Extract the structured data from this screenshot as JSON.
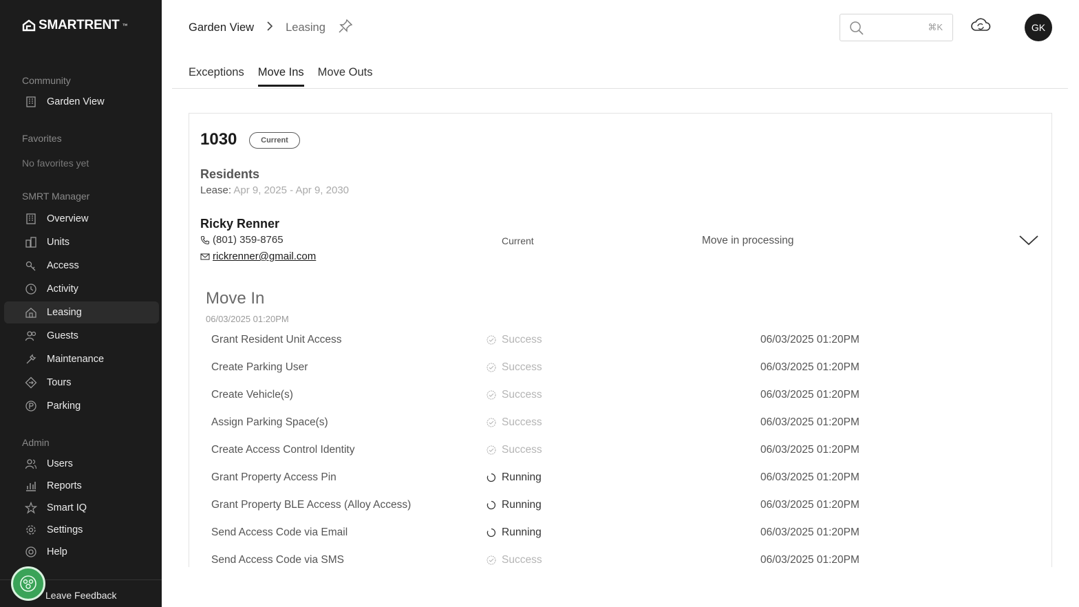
{
  "app": {
    "logo_text": "SMARTRENT",
    "logo_tm": "™"
  },
  "sidebar": {
    "community_label": "Community",
    "community_item": {
      "label": "Garden View",
      "icon": "building-icon"
    },
    "favorites_label": "Favorites",
    "no_favorites": "No favorites yet",
    "manager_label": "SMRT Manager",
    "manager_items": [
      {
        "label": "Overview",
        "icon": "building-icon"
      },
      {
        "label": "Units",
        "icon": "units-icon"
      },
      {
        "label": "Access",
        "icon": "key-icon"
      },
      {
        "label": "Activity",
        "icon": "clock-icon"
      },
      {
        "label": "Leasing",
        "icon": "leasing-icon",
        "active": true
      },
      {
        "label": "Guests",
        "icon": "guests-icon"
      },
      {
        "label": "Maintenance",
        "icon": "wrench-icon"
      },
      {
        "label": "Tours",
        "icon": "tours-icon"
      },
      {
        "label": "Parking",
        "icon": "parking-icon"
      }
    ],
    "admin_label": "Admin",
    "admin_items": [
      {
        "label": "Users",
        "icon": "users-icon"
      },
      {
        "label": "Reports",
        "icon": "reports-icon"
      },
      {
        "label": "Smart IQ",
        "icon": "star-icon"
      },
      {
        "label": "Settings",
        "icon": "gear-icon"
      },
      {
        "label": "Help",
        "icon": "help-icon"
      }
    ],
    "feedback_label": "Leave Feedback"
  },
  "header": {
    "breadcrumb_home": "Garden View",
    "breadcrumb_current": "Leasing",
    "search_placeholder": "",
    "search_shortcut": "⌘K",
    "avatar_initials": "GK"
  },
  "tabs": [
    {
      "label": "Exceptions",
      "active": false
    },
    {
      "label": "Move Ins",
      "active": true
    },
    {
      "label": "Move Outs",
      "active": false
    }
  ],
  "unit": {
    "number": "1030",
    "status": "Current",
    "residents_title": "Residents",
    "lease_label": "Lease:",
    "lease_dates": "Apr 9, 2025 - Apr 9, 2030",
    "resident": {
      "name": "Ricky Renner",
      "phone": "(801) 359-8765",
      "email": "rickrenner@gmail.com",
      "status": "Current",
      "process": "Move in processing"
    }
  },
  "move_in": {
    "title": "Move In",
    "timestamp": "06/03/2025 01:20PM",
    "tasks": [
      {
        "name": "Grant Resident Unit Access",
        "status": "Success",
        "time": "06/03/2025 01:20PM"
      },
      {
        "name": "Create Parking User",
        "status": "Success",
        "time": "06/03/2025 01:20PM"
      },
      {
        "name": "Create Vehicle(s)",
        "status": "Success",
        "time": "06/03/2025 01:20PM"
      },
      {
        "name": "Assign Parking Space(s)",
        "status": "Success",
        "time": "06/03/2025 01:20PM"
      },
      {
        "name": "Create Access Control Identity",
        "status": "Success",
        "time": "06/03/2025 01:20PM"
      },
      {
        "name": "Grant Property Access Pin",
        "status": "Running",
        "time": "06/03/2025 01:20PM"
      },
      {
        "name": "Grant Property BLE Access (Alloy Access)",
        "status": "Running",
        "time": "06/03/2025 01:20PM"
      },
      {
        "name": "Send Access Code via Email",
        "status": "Running",
        "time": "06/03/2025 01:20PM"
      },
      {
        "name": "Send Access Code via SMS",
        "status": "Success",
        "time": "06/03/2025 01:20PM"
      }
    ]
  },
  "colors": {
    "sidebar_bg": "#1c1c1c",
    "feedback_green": "#3aa358",
    "accent": "#1c1c1c"
  }
}
